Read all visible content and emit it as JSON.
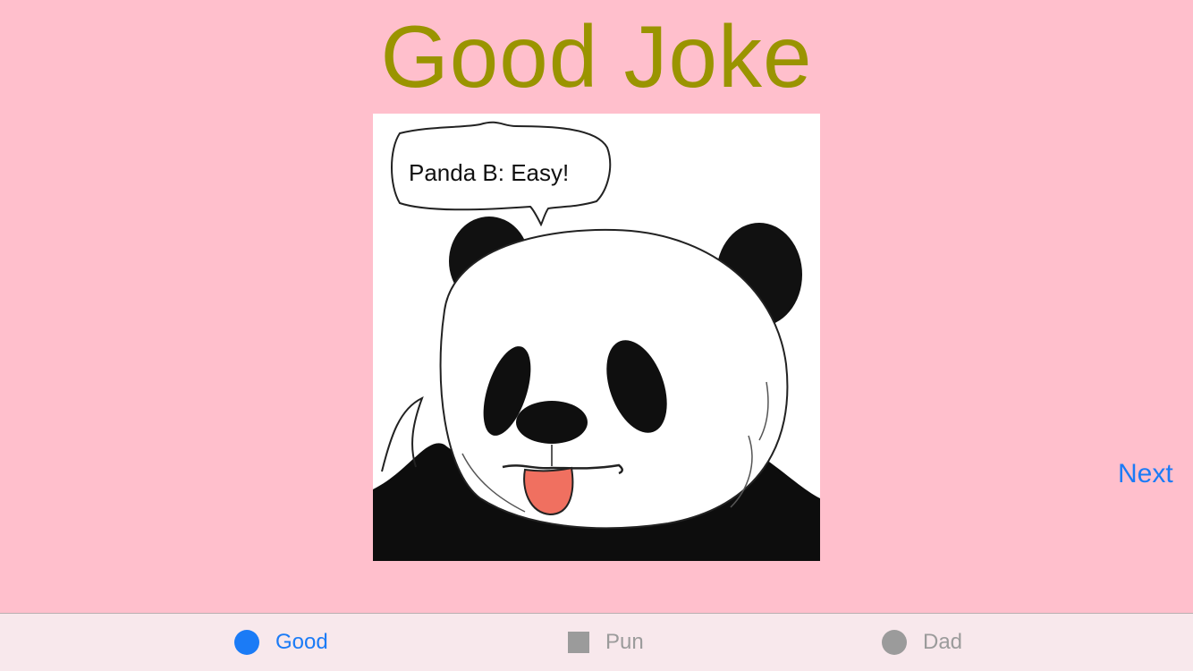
{
  "title": "Good Joke",
  "image": {
    "bubble_text": "Panda B: Easy!"
  },
  "next_label": "Next",
  "tabbar": {
    "active_color": "#1B7BF6",
    "inactive_color": "#9B9B9B",
    "tabs": [
      {
        "label": "Good",
        "icon": "circle-icon",
        "selected": true
      },
      {
        "label": "Pun",
        "icon": "square-icon",
        "selected": false
      },
      {
        "label": "Dad",
        "icon": "circle-icon",
        "selected": false
      }
    ]
  }
}
